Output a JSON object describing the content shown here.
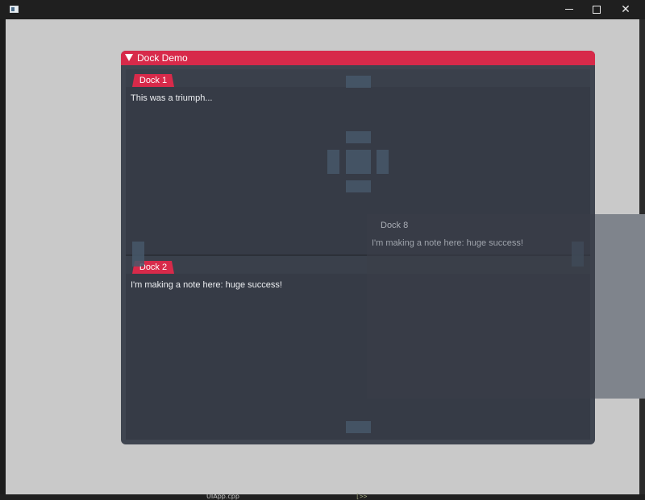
{
  "os_window": {
    "icon": "app-window-icon",
    "controls": {
      "minimize": "minimize-icon",
      "maximize": "maximize-icon",
      "close": "✕"
    }
  },
  "dock_demo": {
    "title": "Dock Demo",
    "accent": "#d72a4a",
    "panes": [
      {
        "tab": "Dock 1",
        "text": "This was a triumph..."
      },
      {
        "tab": "Dock 2",
        "text": "I'm making a note here: huge success!"
      }
    ]
  },
  "floating_dock": {
    "title": "Dock 8",
    "text": "I'm making a note here: huge success!"
  },
  "background": {
    "filename": "UIApp.cpp",
    "code_fragment": "[>>"
  }
}
